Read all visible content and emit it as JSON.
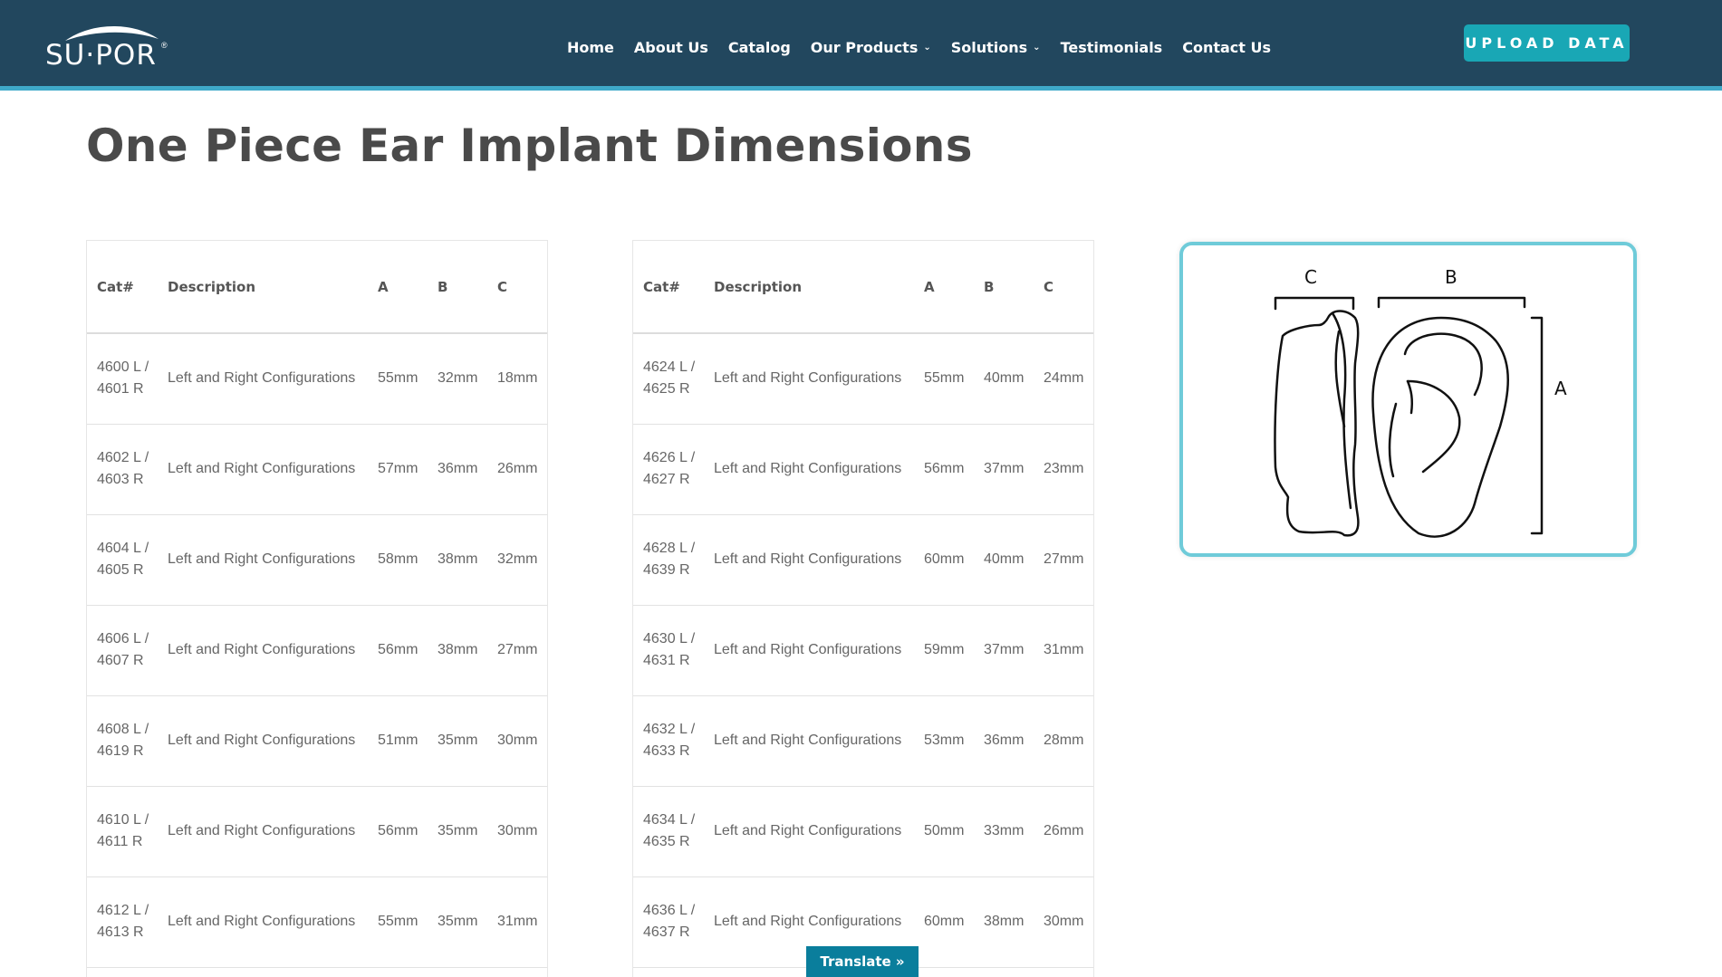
{
  "header": {
    "logo": "SU·POR",
    "logo_mark": "®",
    "nav": [
      {
        "label": "Home",
        "dropdown": false
      },
      {
        "label": "About Us",
        "dropdown": false
      },
      {
        "label": "Catalog",
        "dropdown": false
      },
      {
        "label": "Our Products",
        "dropdown": true
      },
      {
        "label": "Solutions",
        "dropdown": true
      },
      {
        "label": "Testimonials",
        "dropdown": false
      },
      {
        "label": "Contact Us",
        "dropdown": false
      }
    ],
    "upload_label": "UPLOAD DATA"
  },
  "page_title": "One Piece Ear Implant Dimensions",
  "tables": [
    {
      "headers": [
        "Cat#",
        "Description",
        "A",
        "B",
        "C"
      ],
      "rows": [
        [
          "4600 L / 4601 R",
          "Left and Right Configurations",
          "55mm",
          "32mm",
          "18mm"
        ],
        [
          "4602 L / 4603 R",
          "Left and Right Configurations",
          "57mm",
          "36mm",
          "26mm"
        ],
        [
          "4604 L / 4605 R",
          "Left and Right Configurations",
          "58mm",
          "38mm",
          "32mm"
        ],
        [
          "4606 L / 4607 R",
          "Left and Right Configurations",
          "56mm",
          "38mm",
          "27mm"
        ],
        [
          "4608 L / 4619 R",
          "Left and Right Configurations",
          "51mm",
          "35mm",
          "30mm"
        ],
        [
          "4610 L / 4611 R",
          "Left and Right Configurations",
          "56mm",
          "35mm",
          "30mm"
        ],
        [
          "4612 L / 4613 R",
          "Left and Right Configurations",
          "55mm",
          "35mm",
          "31mm"
        ]
      ]
    },
    {
      "headers": [
        "Cat#",
        "Description",
        "A",
        "B",
        "C"
      ],
      "rows": [
        [
          "4624 L / 4625 R",
          "Left and Right Configurations",
          "55mm",
          "40mm",
          "24mm"
        ],
        [
          "4626 L / 4627 R",
          "Left and Right Configurations",
          "56mm",
          "37mm",
          "23mm"
        ],
        [
          "4628 L / 4639 R",
          "Left and Right Configurations",
          "60mm",
          "40mm",
          "27mm"
        ],
        [
          "4630 L / 4631 R",
          "Left and Right Configurations",
          "59mm",
          "37mm",
          "31mm"
        ],
        [
          "4632 L / 4633 R",
          "Left and Right Configurations",
          "53mm",
          "36mm",
          "28mm"
        ],
        [
          "4634 L / 4635 R",
          "Left and Right Configurations",
          "50mm",
          "33mm",
          "26mm"
        ],
        [
          "4636 L / 4637 R",
          "Left and Right Configurations",
          "60mm",
          "38mm",
          "30mm"
        ]
      ]
    }
  ],
  "diagram": {
    "label_c": "C",
    "label_b": "B",
    "label_a": "A"
  },
  "translate_label": "Translate »"
}
